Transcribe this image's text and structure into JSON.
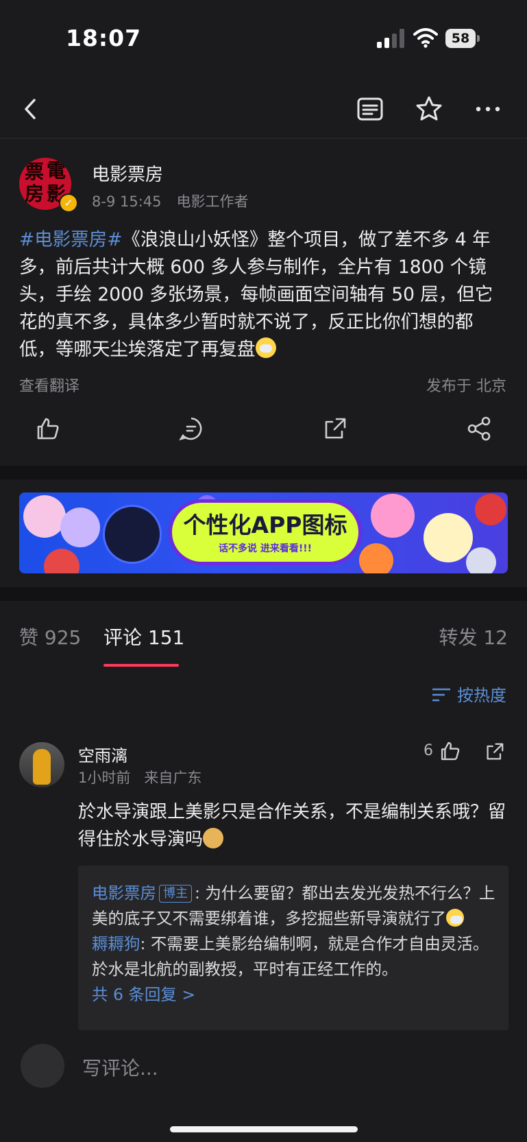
{
  "status": {
    "time": "18:07",
    "battery": "58"
  },
  "nav": {
    "icons": [
      "back-icon",
      "article-icon",
      "star-icon",
      "more-icon"
    ]
  },
  "post": {
    "author": "电影票房",
    "avatar_text": [
      "票",
      "電",
      "房",
      "影"
    ],
    "date": "8-9 15:45",
    "author_title": "电影工作者",
    "hashtag": "#电影票房#",
    "body": "《浪浪山小妖怪》整个项目，做了差不多 4 年多，前后共计大概 600 多人参与制作，全片有 1800 个镜头，手绘 2000 多张场景，每帧画面空间轴有 50 层，但它花的真不多，具体多少暂时就不说了，反正比你们想的都低，等哪天尘埃落定了再复盘",
    "translate": "查看翻译",
    "location": "发布于 北京"
  },
  "banner": {
    "title": "个性化APP图标",
    "subtitle": "话不多说 进来看看!!!"
  },
  "tabs": {
    "likes": "赞 925",
    "comments": "评论 151",
    "reposts": "转发 12"
  },
  "sort_label": "按热度",
  "comment": {
    "user": "空雨漓",
    "time": "1小时前",
    "from": "来自广东",
    "likes": "6",
    "text": "於水导演跟上美影只是合作关系，不是编制关系哦？留得住於水导演吗",
    "replies": [
      {
        "name": "电影票房",
        "badge": "博主",
        "text": ": 为什么要留？都出去发光发热不行么？上美的底子又不需要绑着谁，多挖掘些新导演就行了"
      },
      {
        "name": "耨耨狗",
        "text": ": 不需要上美影给编制啊，就是合作才自由灵活。於水是北航的副教授，平时有正经工作的。"
      }
    ],
    "more_replies": "共 6 条回复 >"
  },
  "input_placeholder": "写评论..."
}
